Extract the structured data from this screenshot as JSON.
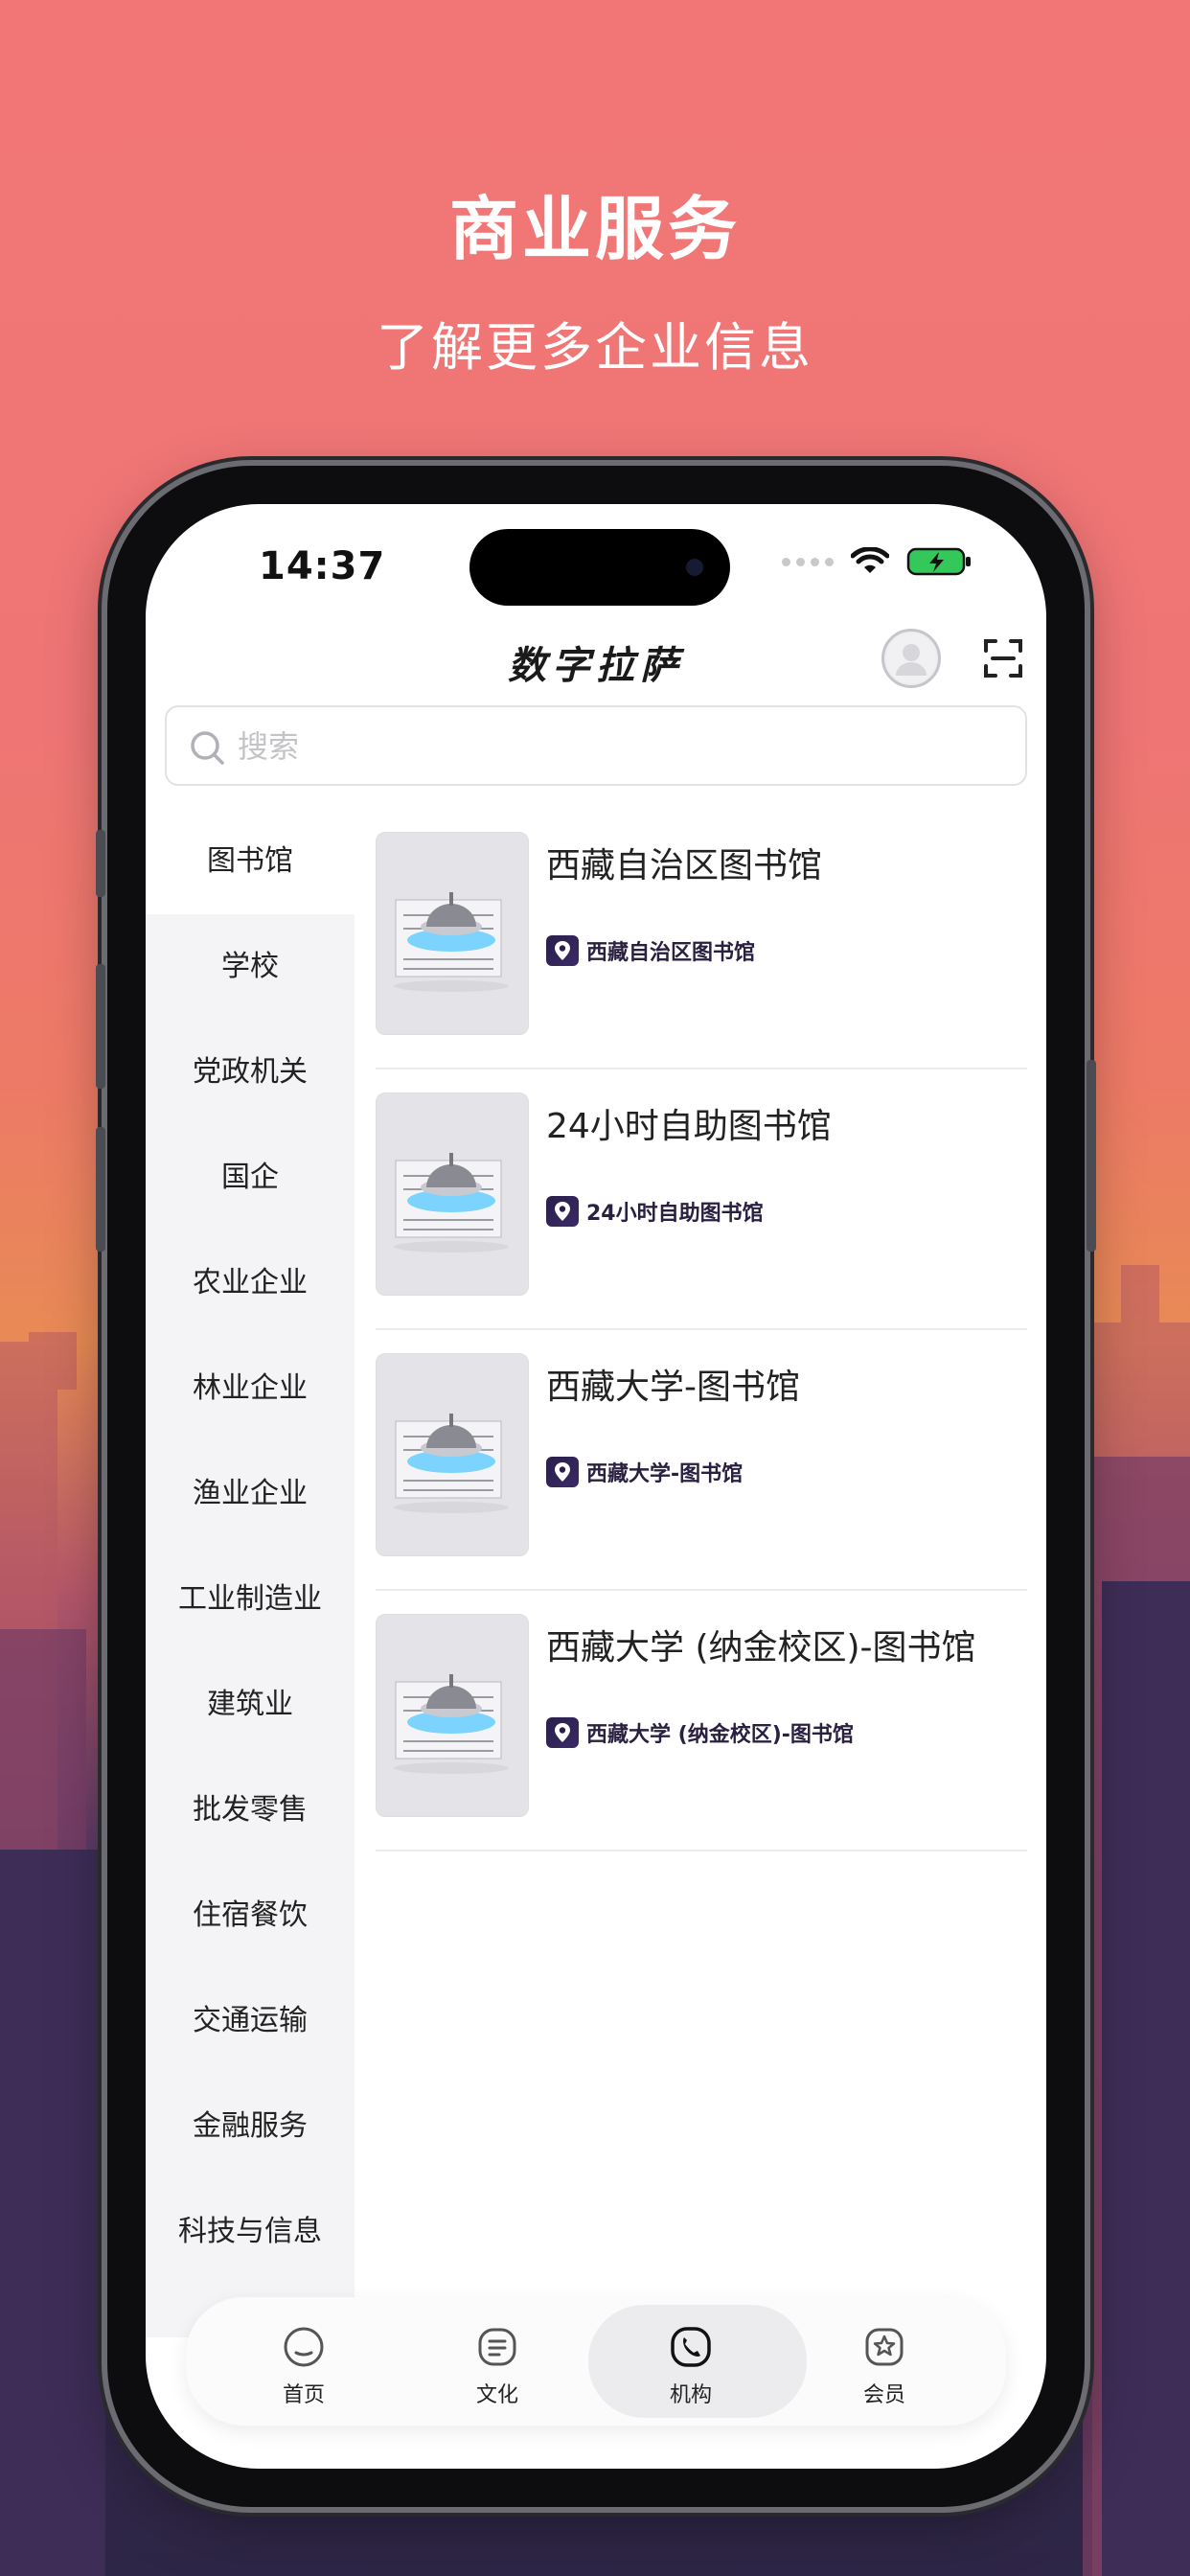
{
  "promo": {
    "title": "商业服务",
    "subtitle": "了解更多企业信息"
  },
  "status_bar": {
    "time": "14:37"
  },
  "header": {
    "app_title": "数字拉萨"
  },
  "search": {
    "placeholder": "搜索",
    "value": ""
  },
  "categories": {
    "active_index": 0,
    "items": [
      "图书馆",
      "学校",
      "党政机关",
      "国企",
      "农业企业",
      "林业企业",
      "渔业企业",
      "工业制造业",
      "建筑业",
      "批发零售",
      "住宿餐饮",
      "交通运输",
      "金融服务",
      "科技与信息"
    ]
  },
  "results": [
    {
      "title": "西藏自治区图书馆",
      "tag": "西藏自治区图书馆"
    },
    {
      "title": "24小时自助图书馆",
      "tag": "24小时自助图书馆"
    },
    {
      "title": "西藏大学-图书馆",
      "tag": "西藏大学-图书馆"
    },
    {
      "title": "西藏大学 (纳金校区)-图书馆",
      "tag": "西藏大学 (纳金校区)-图书馆"
    }
  ],
  "tabbar": {
    "active_index": 2,
    "tabs": [
      {
        "label": "首页",
        "icon": "home-icon"
      },
      {
        "label": "文化",
        "icon": "culture-icon"
      },
      {
        "label": "机构",
        "icon": "phone-icon"
      },
      {
        "label": "会员",
        "icon": "member-icon"
      }
    ]
  },
  "colors": {
    "background_top": "#f27676",
    "tag_badge": "#2a1f4a",
    "battery": "#34c759"
  }
}
